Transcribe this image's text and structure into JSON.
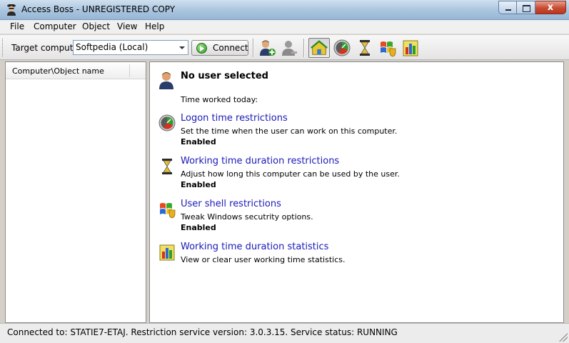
{
  "window": {
    "title": "Access Boss - UNREGISTERED COPY",
    "close_glyph": "x"
  },
  "menu": {
    "items": [
      {
        "label": "File"
      },
      {
        "label": "Computer"
      },
      {
        "label": "Object"
      },
      {
        "label": "View"
      },
      {
        "label": "Help"
      }
    ]
  },
  "toolbar": {
    "target_label": "Target computer",
    "target_value": "Softpedia (Local)",
    "connect_label": "Connect",
    "icons": [
      "add-user-icon",
      "user-disabled-icon",
      "home-icon",
      "clock-icon",
      "hourglass-icon",
      "windows-shield-icon",
      "statistics-icon"
    ]
  },
  "left_panel": {
    "column_header": "Computer\\Object name"
  },
  "right_panel": {
    "title": "No user selected",
    "time_worked": "Time worked today:",
    "sections": [
      {
        "icon": "clock-icon",
        "link": "Logon time restrictions",
        "description": "Set the time when the user can work on this computer.",
        "status": "Enabled"
      },
      {
        "icon": "hourglass-icon",
        "link": "Working time duration restrictions",
        "description": "Adjust how long this computer can be used by the user.",
        "status": "Enabled"
      },
      {
        "icon": "windows-shield-icon",
        "link": "User shell restrictions",
        "description": "Tweak Windows secutrity options.",
        "status": "Enabled"
      },
      {
        "icon": "statistics-icon",
        "link": "Working time duration statistics",
        "description": "View or clear user working time statistics.",
        "status": ""
      }
    ]
  },
  "status_bar": {
    "text": "Connected to: STATIE7-ETAJ.  Restriction service version: 3.0.3.15.  Service status: RUNNING"
  },
  "colors": {
    "link": "#1a1ab8",
    "title_bar": "#a9c4de",
    "close_button": "#c84a30"
  }
}
